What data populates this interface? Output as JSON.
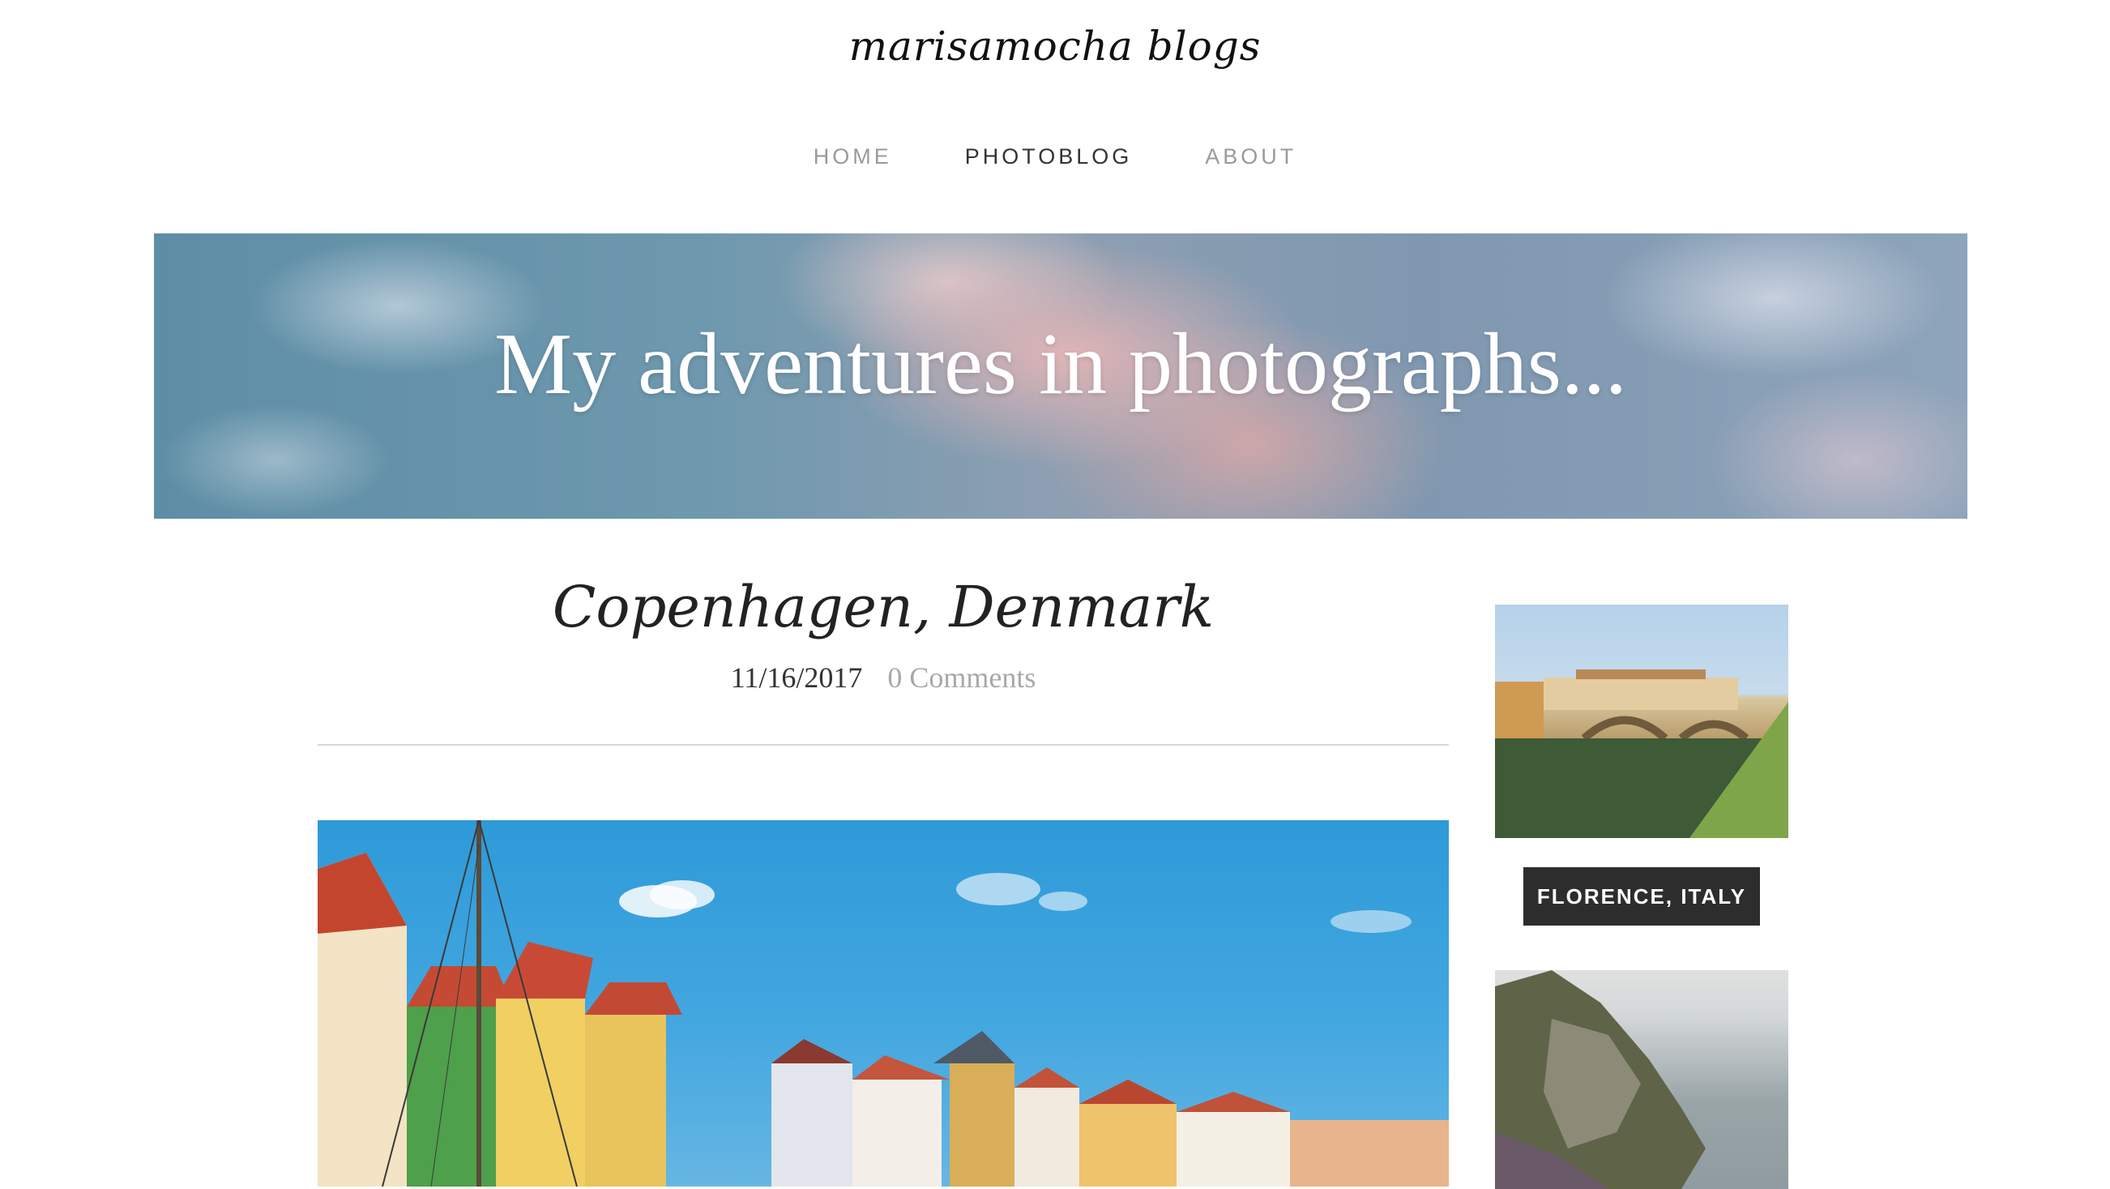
{
  "site": {
    "title": "marisamocha blogs"
  },
  "nav": {
    "items": [
      {
        "label": "HOME",
        "active": false
      },
      {
        "label": "PHOTOBLOG",
        "active": true
      },
      {
        "label": "ABOUT",
        "active": false
      }
    ]
  },
  "banner": {
    "heading": "My adventures in photographs..."
  },
  "post": {
    "title": "Copenhagen, Denmark",
    "date": "11/16/2017",
    "comments": "0 Comments"
  },
  "sidebar": {
    "button_label": "FLORENCE, ITALY"
  },
  "colors": {
    "button_bg": "#2d2d2d",
    "nav_inactive": "#9a9a9a",
    "nav_active": "#333333",
    "comments": "#a8a8a8"
  }
}
